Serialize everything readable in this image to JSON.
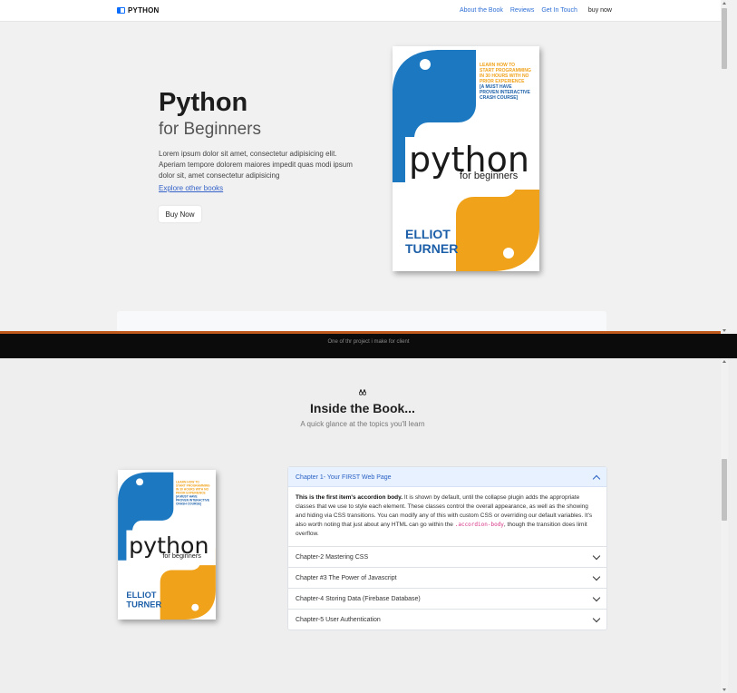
{
  "nav": {
    "brand": "PYTHON",
    "links": [
      "About the Book",
      "Reviews",
      "Get In Touch"
    ],
    "buy": "buy now"
  },
  "hero": {
    "title": "Python",
    "subtitle": "for Beginners",
    "text": "Lorem ipsum dolor sit amet, consectetur adipisicing elit. Aperiam tempore dolorem maiores impedit quas modi ipsum dolor sit, amet consectetur adipisicing",
    "link": "Explore other books",
    "button": "Buy Now"
  },
  "book": {
    "tagline1": "LEARN HOW TO",
    "tagline2": "START PROGRAMMING",
    "tagline3": "IN 30 HOURS WITH NO",
    "tagline4": "PRIOR EXPERIENCE",
    "tagline5": "[A MUST HAVE",
    "tagline6": "PROVEN INTERACTIVE",
    "tagline7": "CRASH COURSE]",
    "title": "python",
    "subtitle": "for beginners",
    "author1": "ELLIOT",
    "author2": "TURNER"
  },
  "caption": "One of thr project i make for client",
  "section": {
    "title": "Inside the Book...",
    "subtitle": "A quick glance at the topics you'll learn"
  },
  "accordion": {
    "items": [
      {
        "label": "Chapter 1- Your FIRST Web Page",
        "open": true
      },
      {
        "label": "Chapter-2 Mastering CSS",
        "open": false
      },
      {
        "label": "Chapter #3 The Power of Javascript",
        "open": false
      },
      {
        "label": "Chapter-4 Storing Data (Firebase Database)",
        "open": false
      },
      {
        "label": "Chapter-5 User Authentication",
        "open": false
      }
    ],
    "body_bold": "This is the first item's accordion body.",
    "body_text": " It is shown by default, until the collapse plugin adds the appropriate classes that we use to style each element. These classes control the overall appearance, as well as the showing and hiding via CSS transitions. You can modify any of this with custom CSS or overriding our default variables. It's also worth noting that just about any HTML can go within the ",
    "body_code": ".accordion-body",
    "body_end": ", though the transition does limit overflow."
  },
  "colors": {
    "python_blue": "#1c78c0",
    "python_yellow": "#f0a21a",
    "link_blue": "#2f6fd6",
    "active_header": "#e7f1ff"
  },
  "icons": {
    "brand": "book-icon",
    "section": "binoculars-icon"
  }
}
